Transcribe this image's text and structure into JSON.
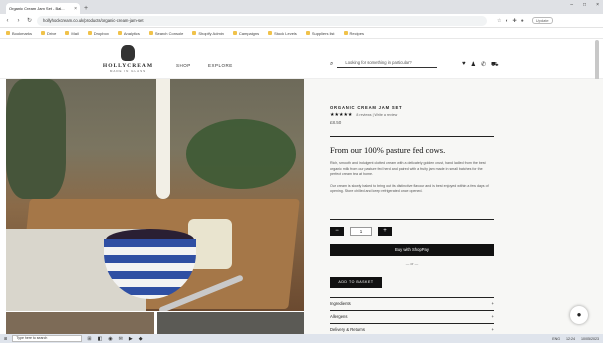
{
  "browser": {
    "tab_title": "Organic Cream Jam Set - Bal...",
    "tab_close": "×",
    "new_tab": "+",
    "window_controls": [
      "–",
      "□",
      "×"
    ],
    "url": "hollyhockcream.co.uk/products/organic-cream-jam-set",
    "update_label": "Update",
    "bookmarks": [
      "Bookmarks",
      "Drive",
      "Mail",
      "Dropbox",
      "Analytics",
      "Search Console",
      "Shopify Admin",
      "Campaigns",
      "Stock Levels",
      "Suppliers list",
      "Recipes"
    ]
  },
  "site": {
    "logo_name": "HOLLYCREAM",
    "logo_sub": "MADE IN GLASS",
    "nav": [
      "SHOP",
      "EXPLORE"
    ],
    "search_placeholder": "Looking for something in particular?",
    "icons": [
      "search-icon",
      "heart-icon",
      "user-icon",
      "phone-icon",
      "basket-icon"
    ]
  },
  "product": {
    "category": "ORGANIC CREAM JAM SET",
    "stars": "★★★★★",
    "reviews": "8 reviews | Write a review",
    "price": "£8.50",
    "tagline": "From our 100% pasture fed cows.",
    "desc1": "Rich, smooth and indulgent clotted cream with a delicately golden crust, hand ladled from the best organic milk from our pasture fed herd and paired with a fruity jam made in small batches for the perfect cream tea at home.",
    "desc2": "Our cream is slowly baked to bring out its distinctive flavour and is best enjoyed within a few days of opening. Store chilled and keep refrigerated once opened.",
    "qty_minus": "−",
    "qty_value": "1",
    "qty_plus": "+",
    "add_label": "Buy with ShopPay",
    "or_label": "— or —",
    "basket_label": "ADD TO BASKET",
    "accordion": [
      "Ingredients",
      "Allergens",
      "Delivery & Returns"
    ],
    "accordion_toggle": "+"
  },
  "taskbar": {
    "search": "Type here to search",
    "apps": [
      "⊞",
      "◧",
      "◉",
      "✉",
      "▶",
      "◆"
    ],
    "tray": [
      "ENG",
      "12:24",
      "10/05/2023"
    ]
  }
}
